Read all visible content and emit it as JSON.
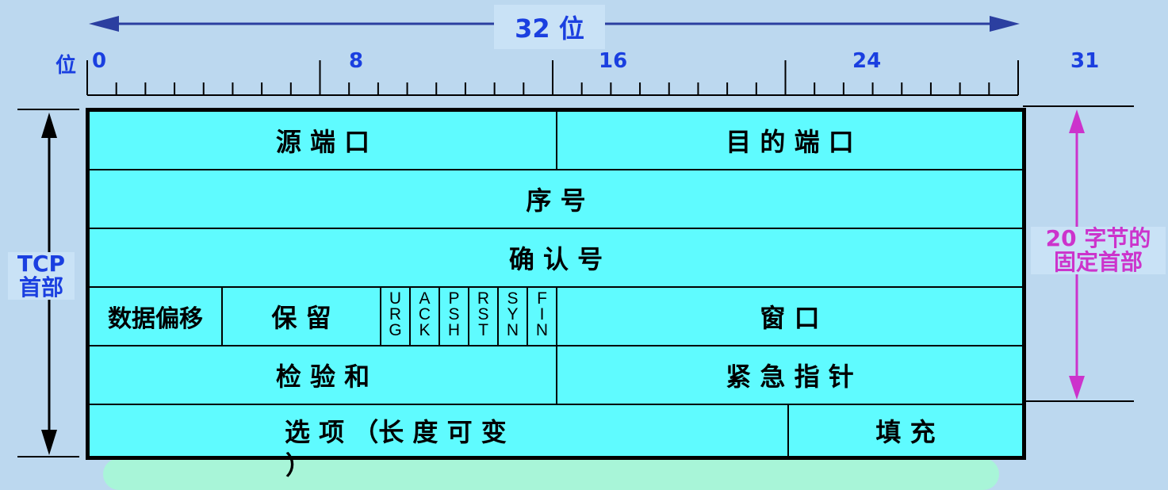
{
  "title": "32 位",
  "bit_axis": {
    "prefix": "位",
    "labels": [
      "0",
      "8",
      "16",
      "24",
      "31"
    ]
  },
  "left_label": {
    "line1": "TCP",
    "line2": "首部"
  },
  "right_label": {
    "line1": "20 字节的",
    "line2": "固定首部"
  },
  "rows": {
    "source_port": "源 端 口",
    "dest_port": "目 的 端 口",
    "seq": "序   号",
    "ack": "确   认   号",
    "data_offset": "数据偏移",
    "reserved": "保   留",
    "flags": [
      [
        "U",
        "R",
        "G"
      ],
      [
        "A",
        "C",
        "K"
      ],
      [
        "P",
        "S",
        "H"
      ],
      [
        "R",
        "S",
        "T"
      ],
      [
        "S",
        "Y",
        "N"
      ],
      [
        "F",
        "I",
        "N"
      ]
    ],
    "window": "窗   口",
    "checksum": "检  验  和",
    "urgent": "紧   急   指   针",
    "options": "选   项   （长 度 可 变",
    "options_tail": "）",
    "padding": "填     充"
  },
  "colors": {
    "background": "#bcd8ef",
    "table_fill": "#5ffbff",
    "title_blue": "#1a3fe0",
    "accent_magenta": "#cc33cc"
  }
}
